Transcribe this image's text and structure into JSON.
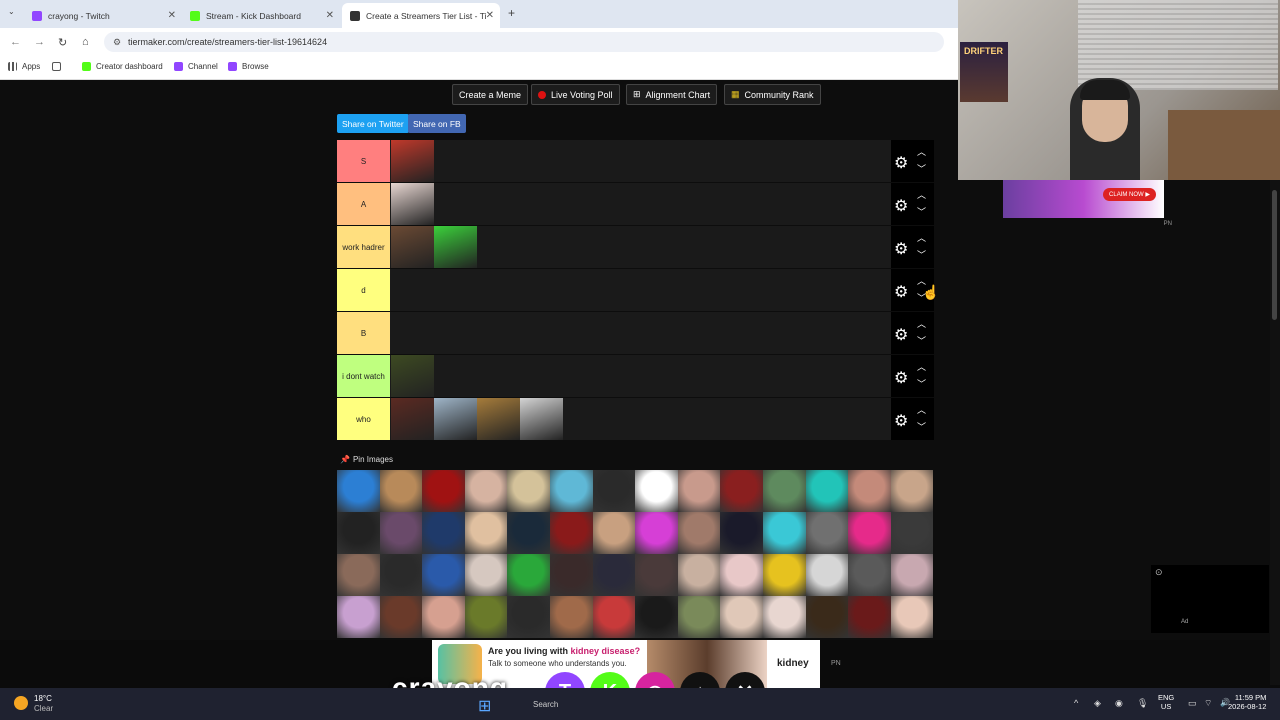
{
  "browser": {
    "tabs": [
      {
        "label": "crayong - Twitch",
        "color": "#9146ff",
        "active": false
      },
      {
        "label": "Stream - Kick Dashboard",
        "color": "#53fc18",
        "active": false
      },
      {
        "label": "Create a Streamers Tier List - Ti",
        "color": "#333333",
        "active": true
      }
    ],
    "url": "tiermaker.com/create/streamers-tier-list-19614624",
    "bookmarks": [
      {
        "label": "Apps",
        "color": "#555555"
      },
      {
        "label": "Creator dashboard",
        "color": "#53fc18"
      },
      {
        "label": "Channel",
        "color": "#9146ff"
      },
      {
        "label": "Browse",
        "color": "#9146ff"
      }
    ]
  },
  "toolbar": {
    "create_meme": "Create a Meme",
    "live_voting": "Live Voting Poll",
    "alignment": "Alignment Chart",
    "community_rank": "Community Rank",
    "share_twitter": "Share on Twitter",
    "share_fb": "Share on FB"
  },
  "tiers": [
    {
      "label": "S",
      "color": "#ff7f7f",
      "images": [
        "#c0392b"
      ]
    },
    {
      "label": "A",
      "color": "#ffbf7f",
      "images": [
        "#e8d7d2"
      ]
    },
    {
      "label": "work hadrer",
      "color": "#ffdf7f",
      "images": [
        "#6b4a34",
        "#3bd13b"
      ]
    },
    {
      "label": "d",
      "color": "#ffff7f",
      "images": []
    },
    {
      "label": "B",
      "color": "#ffdf7f",
      "images": []
    },
    {
      "label": "i dont watch",
      "color": "#bfff7f",
      "images": [
        "#3d4a22"
      ]
    },
    {
      "label": "who",
      "color": "#ffff7f",
      "images": [
        "#5b2a22",
        "#9fb5c8",
        "#a67c3b",
        "#d4d4d4"
      ]
    }
  ],
  "pool": {
    "label": "Pin Images",
    "images": [
      "#2c7fd4",
      "#b88a5a",
      "#a01212",
      "#d6b3a1",
      "#d4c29a",
      "#5fb8d6",
      "#2a2a2a",
      "#ffffff",
      "#c89a8c",
      "#8a1f1f",
      "#5e8a5e",
      "#22c4b8",
      "#c48a7a",
      "#c8a58a",
      "#222222",
      "#6a4a6a",
      "#1f3a6a",
      "#e0c0a0",
      "#1a2a3a",
      "#8a1a1a",
      "#c8a080",
      "#d63fd6",
      "#a07a6a",
      "#1a1a2a",
      "#3ac8d6",
      "#707070",
      "#e62a8a",
      "#3a3a3a",
      "#8a6a5a",
      "#2a2a2a",
      "#2a5aaa",
      "#d6c8c0",
      "#2aa83a",
      "#3a2a2a",
      "#2a2a3a",
      "#4a3a3a",
      "#c8b0a0",
      "#e8c8c8",
      "#e6c21f",
      "#d6d6d6",
      "#5a5a5a",
      "#c8a8b0",
      "#c8a0d0",
      "#6a3a2a",
      "#d6a090",
      "#6a7a2a",
      "#2a2a2a",
      "#a06a4a",
      "#c83a3a",
      "#1a1a1a",
      "#7a8a5a",
      "#e0c8b8",
      "#e8d6d0",
      "#3a2a1a",
      "#6a1a1a",
      "#e8c8b8"
    ]
  },
  "webcam": {
    "poster_text": "DRIFTER"
  },
  "ads": {
    "side_claim": "CLAIM NOW ▶",
    "side_pn": "PN",
    "right_ad": "Ad",
    "bottom_headline": "Are you living with",
    "bottom_headline_em": "kidney disease?",
    "bottom_sub": "Talk to someone who understands you.",
    "bottom_brand": "kidney",
    "bottom_pn": "PN"
  },
  "stream_overlay": {
    "name": "crayong",
    "socials": [
      {
        "name": "twitch",
        "glyph": "T",
        "color": "#9146ff"
      },
      {
        "name": "kick",
        "glyph": "K",
        "color": "#53fc18"
      },
      {
        "name": "instagram",
        "glyph": "◎",
        "color": "#d6249f"
      },
      {
        "name": "tiktok",
        "glyph": "♪",
        "color": "#111111"
      },
      {
        "name": "x",
        "glyph": "✕",
        "color": "#111111"
      }
    ]
  },
  "taskbar": {
    "temp": "18°C",
    "condition": "Clear",
    "search": "Search",
    "lang1": "ENG",
    "lang2": "US",
    "time": "11:59 PM",
    "date": "2026-08-12"
  }
}
